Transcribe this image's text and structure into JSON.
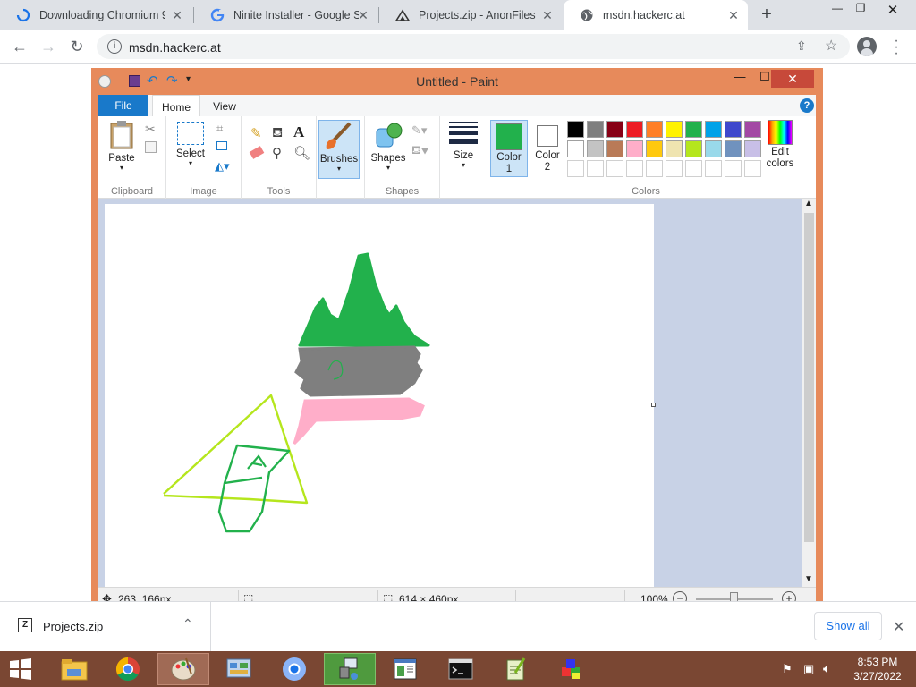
{
  "browser": {
    "tabs": [
      {
        "title": "Downloading Chromium 9",
        "favicon": "loading-spinner-icon",
        "active": false
      },
      {
        "title": "Ninite Installer - Google Se",
        "favicon": "google-g-icon",
        "active": false
      },
      {
        "title": "Projects.zip - AnonFiles",
        "favicon": "anonfiles-icon",
        "active": false
      },
      {
        "title": "msdn.hackerc.at",
        "favicon": "globe-icon",
        "active": true
      }
    ],
    "address": "msdn.hackerc.at"
  },
  "paint": {
    "title": "Untitled - Paint",
    "tabs": {
      "file": "File",
      "home": "Home",
      "view": "View"
    },
    "groups": {
      "clipboard": {
        "label": "Clipboard",
        "paste": "Paste"
      },
      "image": {
        "label": "Image",
        "select": "Select"
      },
      "tools": {
        "label": "Tools"
      },
      "brushes": {
        "label": "Brushes"
      },
      "shapes": {
        "label": "Shapes",
        "shapes_btn": "Shapes"
      },
      "size": {
        "label": "Size"
      },
      "colors": {
        "label": "Colors",
        "color1": "Color 1",
        "color2": "Color 2",
        "edit": "Edit colors"
      }
    },
    "color1_value": "#22b14c",
    "palette_row1": [
      "#000000",
      "#7f7f7f",
      "#880015",
      "#ed1c24",
      "#ff7f27",
      "#fff200",
      "#22b14c",
      "#00a2e8",
      "#3f48cc",
      "#a349a4"
    ],
    "palette_row2": [
      "#ffffff",
      "#c3c3c3",
      "#b97a57",
      "#ffaec9",
      "#ffc90e",
      "#efe4b0",
      "#b5e61d",
      "#99d9ea",
      "#7092be",
      "#c8bfe7"
    ],
    "status": {
      "cursor_pos": "263, 166px",
      "canvas_size": "614 × 460px",
      "zoom": "100%"
    }
  },
  "download": {
    "filename": "Projects.zip",
    "show_all": "Show all"
  },
  "taskbar": {
    "time": "8:53 PM",
    "date": "3/27/2022"
  }
}
